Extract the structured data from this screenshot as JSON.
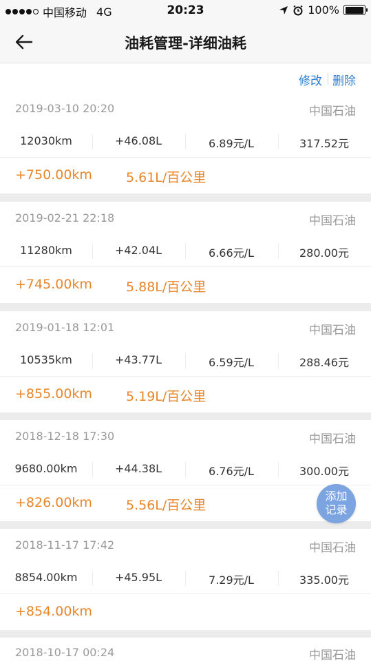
{
  "status_bar": {
    "carrier": "中国移动",
    "network": "4G",
    "time": "20:23",
    "battery": "100%"
  },
  "nav": {
    "title": "油耗管理-详细油耗"
  },
  "actions": {
    "edit_label": "修改",
    "delete_label": "删除"
  },
  "records": [
    {
      "datetime": "2019-03-10 20:20",
      "station": "中国石油",
      "odometer": "12030km",
      "fuel": "+46.08L",
      "price": "6.89元/L",
      "cost": "317.52元",
      "distance": "+750.00km",
      "consumption": "5.61L/百公里"
    },
    {
      "datetime": "2019-02-21 22:18",
      "station": "中国石油",
      "odometer": "11280km",
      "fuel": "+42.04L",
      "price": "6.66元/L",
      "cost": "280.00元",
      "distance": "+745.00km",
      "consumption": "5.88L/百公里"
    },
    {
      "datetime": "2019-01-18 12:01",
      "station": "中国石油",
      "odometer": "10535km",
      "fuel": "+43.77L",
      "price": "6.59元/L",
      "cost": "288.46元",
      "distance": "+855.00km",
      "consumption": "5.19L/百公里"
    },
    {
      "datetime": "2018-12-18 17:30",
      "station": "中国石油",
      "odometer": "9680.00km",
      "fuel": "+44.38L",
      "price": "6.76元/L",
      "cost": "300.00元",
      "distance": "+826.00km",
      "consumption": "5.56L/百公里"
    },
    {
      "datetime": "2018-11-17 17:42",
      "station": "中国石油",
      "odometer": "8854.00km",
      "fuel": "+45.95L",
      "price": "7.29元/L",
      "cost": "335.00元",
      "distance": "+854.00km",
      "consumption": ""
    },
    {
      "datetime": "2018-10-17 00:24",
      "station": "中国石油"
    }
  ],
  "fab": {
    "line1": "添加",
    "line2": "记录"
  },
  "colors": {
    "accent_blue": "#2f7fd0",
    "orange": "#e8862a",
    "fab": "#7ba4e0",
    "muted_text": "#999999"
  },
  "icons": [
    "back-arrow-icon",
    "location-arrow-icon",
    "alarm-clock-icon",
    "battery-icon"
  ]
}
